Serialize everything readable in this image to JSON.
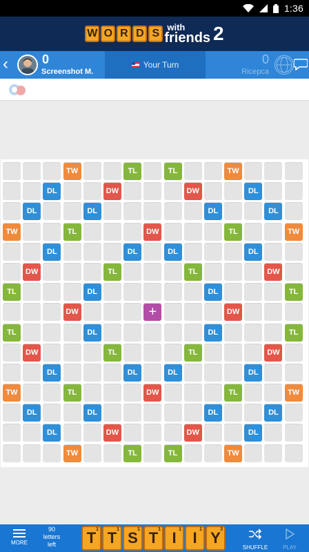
{
  "status_bar": {
    "time": "1:36"
  },
  "logo": {
    "word": [
      "W",
      "O",
      "R",
      "D",
      "S"
    ],
    "with": "with",
    "friends": "friends",
    "number": "2"
  },
  "player_bar": {
    "left": {
      "score": "0",
      "name": "Screenshot M."
    },
    "middle": {
      "turn_text": "Your Turn"
    },
    "right": {
      "score": "0",
      "name": "Ricepca"
    }
  },
  "board": {
    "center_symbol": "+",
    "rows": [
      [
        "",
        "",
        "",
        "TW",
        "",
        "",
        "TL",
        "",
        "TL",
        "",
        "",
        "TW",
        "",
        "",
        ""
      ],
      [
        "",
        "",
        "DL",
        "",
        "",
        "DW",
        "",
        "",
        "",
        "DW",
        "",
        "",
        "DL",
        "",
        ""
      ],
      [
        "",
        "DL",
        "",
        "",
        "DL",
        "",
        "",
        "",
        "",
        "",
        "DL",
        "",
        "",
        "DL",
        ""
      ],
      [
        "TW",
        "",
        "",
        "TL",
        "",
        "",
        "",
        "DW",
        "",
        "",
        "",
        "TL",
        "",
        "",
        "TW"
      ],
      [
        "",
        "",
        "DL",
        "",
        "",
        "",
        "DL",
        "",
        "DL",
        "",
        "",
        "",
        "DL",
        "",
        ""
      ],
      [
        "",
        "DW",
        "",
        "",
        "",
        "TL",
        "",
        "",
        "",
        "TL",
        "",
        "",
        "",
        "DW",
        ""
      ],
      [
        "TL",
        "",
        "",
        "",
        "DL",
        "",
        "",
        "",
        "",
        "",
        "DL",
        "",
        "",
        "",
        "TL"
      ],
      [
        "",
        "",
        "",
        "DW",
        "",
        "",
        "",
        "CENTER",
        "",
        "",
        "",
        "DW",
        "",
        "",
        ""
      ],
      [
        "TL",
        "",
        "",
        "",
        "DL",
        "",
        "",
        "",
        "",
        "",
        "DL",
        "",
        "",
        "",
        "TL"
      ],
      [
        "",
        "DW",
        "",
        "",
        "",
        "TL",
        "",
        "",
        "",
        "TL",
        "",
        "",
        "",
        "DW",
        ""
      ],
      [
        "",
        "",
        "DL",
        "",
        "",
        "",
        "DL",
        "",
        "DL",
        "",
        "",
        "",
        "DL",
        "",
        ""
      ],
      [
        "TW",
        "",
        "",
        "TL",
        "",
        "",
        "",
        "DW",
        "",
        "",
        "",
        "TL",
        "",
        "",
        "TW"
      ],
      [
        "",
        "DL",
        "",
        "",
        "DL",
        "",
        "",
        "",
        "",
        "",
        "DL",
        "",
        "",
        "DL",
        ""
      ],
      [
        "",
        "",
        "DL",
        "",
        "",
        "DW",
        "",
        "",
        "",
        "DW",
        "",
        "",
        "DL",
        "",
        ""
      ],
      [
        "",
        "",
        "",
        "TW",
        "",
        "",
        "TL",
        "",
        "TL",
        "",
        "",
        "TW",
        "",
        "",
        ""
      ]
    ]
  },
  "bottom_bar": {
    "more_label": "MORE",
    "letters_count": "90",
    "letters_label_1": "letters",
    "letters_label_2": "left",
    "rack": [
      {
        "letter": "T",
        "points": "1"
      },
      {
        "letter": "T",
        "points": "1"
      },
      {
        "letter": "S",
        "points": "1"
      },
      {
        "letter": "T",
        "points": "1"
      },
      {
        "letter": "I",
        "points": "1"
      },
      {
        "letter": "I",
        "points": "1"
      },
      {
        "letter": "Y",
        "points": "3"
      }
    ],
    "shuffle_label": "SHUFFLE",
    "play_label": "PLAY"
  },
  "colors": {
    "TW": "#f08a3c",
    "DW": "#e3564a",
    "TL": "#85b73c",
    "DL": "#2f8fd8",
    "CENTER": "#b24da8"
  }
}
